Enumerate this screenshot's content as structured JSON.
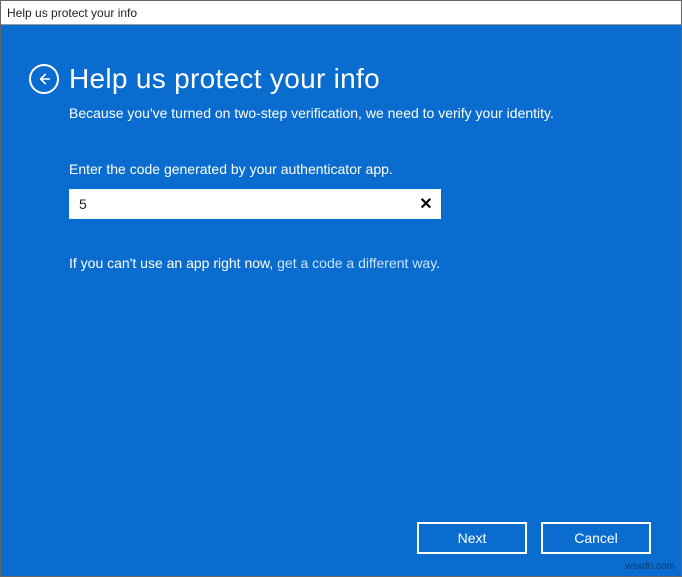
{
  "window": {
    "title": "Help us protect your info"
  },
  "header": {
    "title": "Help us protect your info",
    "subtitle": "Because you've turned on two-step verification, we need to verify your identity."
  },
  "form": {
    "code_label": "Enter the code generated by your authenticator app.",
    "code_value": "5",
    "help_prefix": "If you can't use an app right now, ",
    "help_link": "get a code a different way",
    "help_suffix": "."
  },
  "buttons": {
    "next": "Next",
    "cancel": "Cancel"
  },
  "watermark": "wsxdn.com"
}
